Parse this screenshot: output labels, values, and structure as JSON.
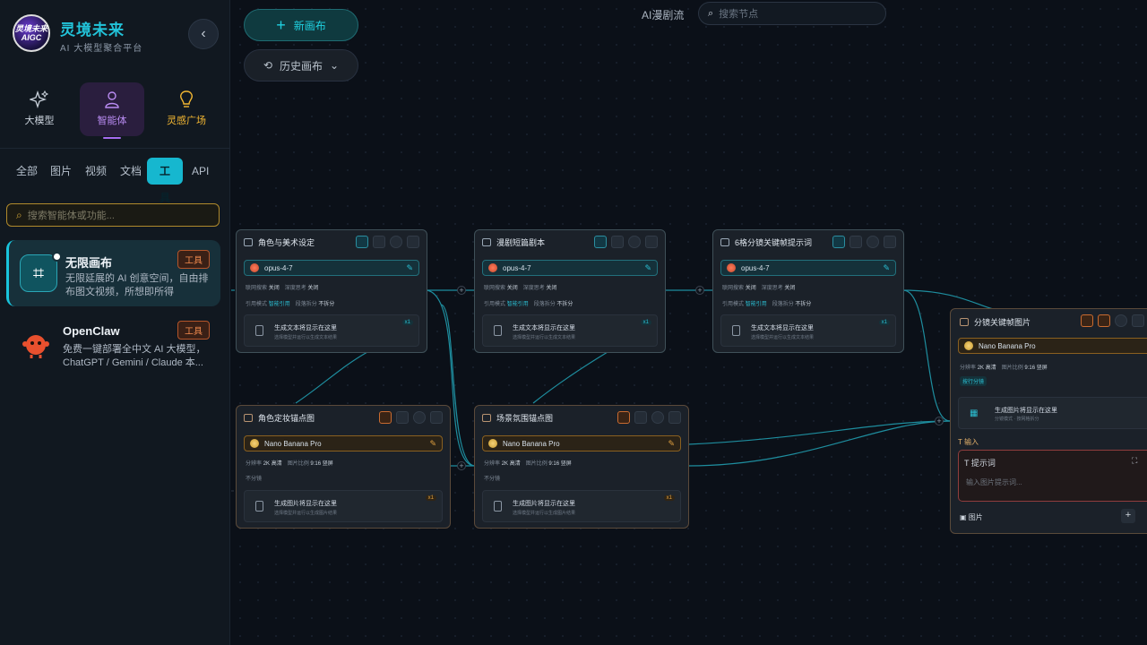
{
  "brand": {
    "name": "灵境未来",
    "subtitle": "AI 大模型聚合平台",
    "logo_text": "灵境未来 AIGC"
  },
  "modes": [
    {
      "label": "大模型",
      "icon": "sparkle-icon"
    },
    {
      "label": "智能体",
      "icon": "user-icon",
      "active": true
    },
    {
      "label": "灵感广场",
      "icon": "lightbulb-icon"
    }
  ],
  "categories": [
    "全部",
    "图片",
    "视频",
    "文档",
    "工具",
    "API"
  ],
  "active_category": "工具",
  "sidebar_search": {
    "placeholder": "搜索智能体或功能..."
  },
  "agents": [
    {
      "title": "无限画布",
      "desc": "无限延展的 AI 创意空间，自由排布图文视频，所想即所得",
      "tag": "工具",
      "selected": true
    },
    {
      "title": "OpenClaw",
      "desc": "免费一键部署全中文 AI 大模型，ChatGPT / Gemini / Claude 本...",
      "tag": "工具"
    }
  ],
  "toolbar": {
    "new_canvas": "新画布",
    "history": "历史画布"
  },
  "flow_title": "AI漫剧流",
  "node_search": {
    "placeholder": "搜索节点"
  },
  "nodes": {
    "n1": {
      "title": "角色与美术设定",
      "model": "opus-4-7",
      "meta1": [
        "联网搜索",
        "关闭",
        "深度思考",
        "关闭"
      ],
      "meta2": [
        "引用模式",
        "智能引用",
        "段落拆分",
        "不拆分"
      ],
      "out_title": "生成文本将显示在这里",
      "out_sub": "选择模型并运行以生成文本结果",
      "badge": "x1"
    },
    "n2": {
      "title": "漫剧短篇剧本",
      "model": "opus-4-7",
      "meta1": [
        "联网搜索",
        "关闭",
        "深度思考",
        "关闭"
      ],
      "meta2": [
        "引用模式",
        "智能引用",
        "段落拆分",
        "不拆分"
      ],
      "out_title": "生成文本将显示在这里",
      "out_sub": "选择模型并运行以生成文本结果",
      "badge": "x1"
    },
    "n3": {
      "title": "6格分镜关键帧提示词",
      "model": "opus-4-7",
      "meta1": [
        "联网搜索",
        "关闭",
        "深度思考",
        "关闭"
      ],
      "meta2": [
        "引用模式",
        "智能引用",
        "段落拆分",
        "不拆分"
      ],
      "out_title": "生成文本将显示在这里",
      "out_sub": "选择模型并运行以生成文本结果",
      "badge": "x1"
    },
    "n4": {
      "title": "角色定妆锚点图",
      "model": "Nano Banana Pro",
      "meta1": [
        "分辨率",
        "2K 高清",
        "图片比例",
        "9:16 竖屏"
      ],
      "meta2": [
        "不分镜"
      ],
      "out_title": "生成图片将显示在这里",
      "out_sub": "选择模型并运行以生成图片结果",
      "badge": "x1"
    },
    "n5": {
      "title": "场景氛围锚点图",
      "model": "Nano Banana Pro",
      "meta1": [
        "分辨率",
        "2K 高清",
        "图片比例",
        "9:16 竖屏"
      ],
      "meta2": [
        "不分镜"
      ],
      "out_title": "生成图片将显示在这里",
      "out_sub": "选择模型并运行以生成图片结果",
      "badge": "x1"
    },
    "n6": {
      "title": "分镜关键帧图片",
      "model": "Nano Banana Pro",
      "meta1": [
        "分辨率",
        "2K 高清",
        "图片比例",
        "9:16 竖屏"
      ],
      "split": "按行分镜",
      "out_title": "生成图片将显示在这里",
      "out_sub": "分镜模式 · 按网格拆分",
      "input_label": "输入",
      "prompt_label": "提示词",
      "prompt_placeholder": "输入图片提示词...",
      "image_label": "图片"
    }
  },
  "colors": {
    "accent": "#16b7cf",
    "brand": "#22c3d9",
    "warn": "#f08a4e",
    "purple": "#b98bf2",
    "gold": "#f2b632"
  }
}
